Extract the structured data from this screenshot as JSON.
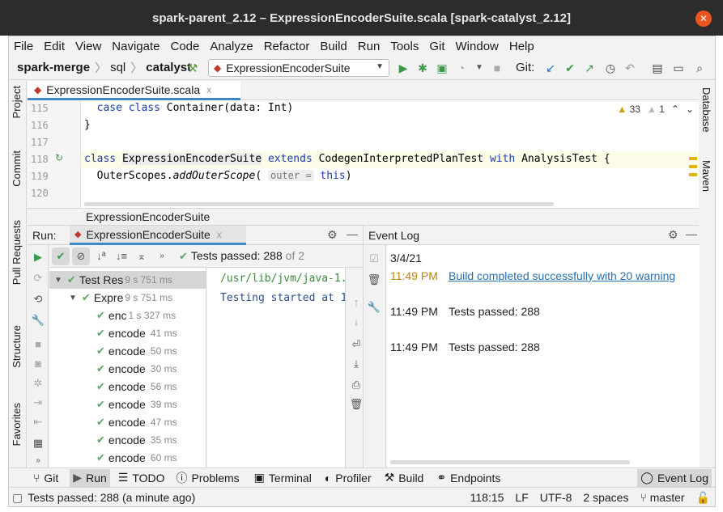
{
  "window": {
    "title": "spark-parent_2.12 – ExpressionEncoderSuite.scala [spark-catalyst_2.12]",
    "close_glyph": "✕"
  },
  "menu": [
    "File",
    "Edit",
    "View",
    "Navigate",
    "Code",
    "Analyze",
    "Refactor",
    "Build",
    "Run",
    "Tools",
    "Git",
    "Window",
    "Help"
  ],
  "navbar": {
    "crumbs": [
      "spark-merge",
      "sql",
      "catalyst"
    ],
    "run_config": "ExpressionEncoderSuite",
    "git_label": "Git:"
  },
  "left_tools": [
    "Project",
    "Commit",
    "Pull Requests",
    "Structure",
    "Favorites"
  ],
  "right_tools": [
    "Database",
    "Maven"
  ],
  "editor_tab": {
    "label": "ExpressionEncoderSuite.scala",
    "close": "x"
  },
  "editor": {
    "inspections": {
      "warnings": "33",
      "weak_warnings": "1"
    },
    "lines": [
      {
        "num": "115",
        "text": "  case class Container(data: Int)"
      },
      {
        "num": "116",
        "text": "}"
      },
      {
        "num": "117",
        "text": ""
      },
      {
        "num": "118",
        "text": "class ExpressionEncoderSuite extends CodegenInterpretedPlanTest with AnalysisTest {"
      },
      {
        "num": "119",
        "text": "  OuterScopes.addOuterScope( outer = this)"
      },
      {
        "num": "120",
        "text": ""
      }
    ],
    "line119": {
      "obj": "OuterScopes.",
      "method": "addOuterScope",
      "paren": "(",
      "hint": "outer =",
      "arg": "this",
      "close": ")"
    },
    "line115": {
      "kw": "case class",
      "rest": "Container(data: Int)"
    },
    "line118": {
      "kw1": "class",
      "name": "ExpressionEncoderSuite",
      "kw2": "extends",
      "base": "CodegenInterpretedPlanTest",
      "kw3": "with",
      "trait": "AnalysisTest {"
    }
  },
  "editor_breadcrumb": "ExpressionEncoderSuite",
  "run": {
    "label": "Run:",
    "tab": "ExpressionEncoderSuite",
    "status": "Tests passed: 288",
    "status_more": "of 2",
    "tree": [
      {
        "name": "Test Res",
        "time": "9 s 751 ms",
        "level": 0,
        "selected": true
      },
      {
        "name": "Expre",
        "time": "9 s 751 ms",
        "level": 1
      },
      {
        "name": "enc",
        "time": "1 s 327 ms",
        "level": 2
      },
      {
        "name": "encode",
        "time": "41 ms",
        "level": 2
      },
      {
        "name": "encode",
        "time": "50 ms",
        "level": 2
      },
      {
        "name": "encode",
        "time": "30 ms",
        "level": 2
      },
      {
        "name": "encode",
        "time": "56 ms",
        "level": 2
      },
      {
        "name": "encode",
        "time": "39 ms",
        "level": 2
      },
      {
        "name": "encode",
        "time": "47 ms",
        "level": 2
      },
      {
        "name": "encode",
        "time": "35 ms",
        "level": 2
      },
      {
        "name": "encode",
        "time": "60 ms",
        "level": 2
      }
    ],
    "console": [
      "/usr/lib/jvm/java-1.",
      "Testing started at 1"
    ]
  },
  "event_log": {
    "title": "Event Log",
    "date": "3/4/21",
    "entries": [
      {
        "time": "11:49 PM",
        "text": "Build completed successfully with 20 warning",
        "link": true
      },
      {
        "time": "11:49 PM",
        "text": "Tests passed: 288",
        "link": false
      },
      {
        "time": "11:49 PM",
        "text": "Tests passed: 288",
        "link": false
      }
    ]
  },
  "bottom_tools": [
    "Git",
    "Run",
    "TODO",
    "Problems",
    "Terminal",
    "Profiler",
    "Build",
    "Endpoints"
  ],
  "bottom_right_tool": "Event Log",
  "status": {
    "message": "Tests passed: 288 (a minute ago)",
    "position": "118:15",
    "line_sep": "LF",
    "encoding": "UTF-8",
    "indent": "2 spaces",
    "branch": "master"
  },
  "colors": {
    "accent": "#3f88c5",
    "pass": "#59a869",
    "link": "#2470b3",
    "close": "#e95420"
  }
}
